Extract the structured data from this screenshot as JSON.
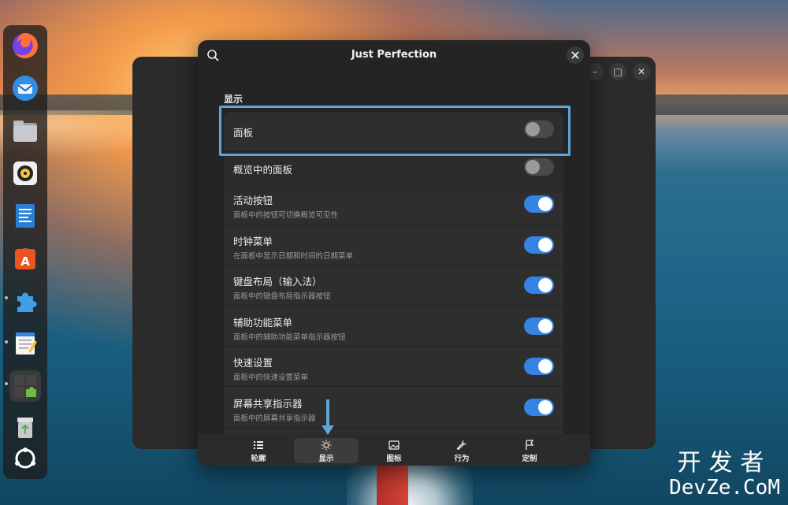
{
  "window": {
    "title": "Just Perfection"
  },
  "section": {
    "title": "显示"
  },
  "rows": [
    {
      "title": "面板",
      "subtitle": "",
      "enabled": false
    },
    {
      "title": "概览中的面板",
      "subtitle": "",
      "enabled": false
    },
    {
      "title": "活动按钮",
      "subtitle": "面板中的按钮可切换概览可见性",
      "enabled": true
    },
    {
      "title": "时钟菜单",
      "subtitle": "在面板中显示日期和时间的日期菜单",
      "enabled": true
    },
    {
      "title": "键盘布局（输入法）",
      "subtitle": "面板中的键盘布局指示器按钮",
      "enabled": true
    },
    {
      "title": "辅助功能菜单",
      "subtitle": "面板中的辅助功能菜单指示器按钮",
      "enabled": true
    },
    {
      "title": "快速设置",
      "subtitle": "面板中的快速设置菜单",
      "enabled": true
    },
    {
      "title": "屏幕共享指示器",
      "subtitle": "面板中的屏幕共享指示器",
      "enabled": true
    }
  ],
  "view_switcher": [
    {
      "label": "轮廓",
      "icon": "list-icon",
      "active": false
    },
    {
      "label": "显示",
      "icon": "sun-icon",
      "active": true
    },
    {
      "label": "图标",
      "icon": "image-icon",
      "active": false
    },
    {
      "label": "行为",
      "icon": "wrench-icon",
      "active": false
    },
    {
      "label": "定制",
      "icon": "customize-icon",
      "active": false
    }
  ],
  "dock": [
    {
      "icon": "firefox-icon",
      "color": "#ff7139"
    },
    {
      "icon": "thunderbird-icon",
      "color": "#2f8ee5"
    },
    {
      "icon": "files-icon",
      "color": "#9aa0a6"
    },
    {
      "icon": "rhythmbox-icon",
      "color": "#f2c744"
    },
    {
      "icon": "writer-icon",
      "color": "#2a7fd4"
    },
    {
      "icon": "app-center-icon",
      "color": "#e95420"
    },
    {
      "icon": "extensions-icon",
      "color": "#3f9ee6"
    },
    {
      "icon": "text-editor-icon",
      "color": "#f5f5f5"
    },
    {
      "icon": "extension-manager-icon",
      "color": "#6cbd3e"
    },
    {
      "icon": "trash-icon",
      "color": "#c9c9c9"
    },
    {
      "icon": "show-apps-icon",
      "color": "#ffffff"
    }
  ],
  "watermark": {
    "cn": "开发者",
    "en": "DevZe.CoM"
  },
  "colors": {
    "accent": "#3584e4",
    "highlight": "#5fa6d6"
  }
}
